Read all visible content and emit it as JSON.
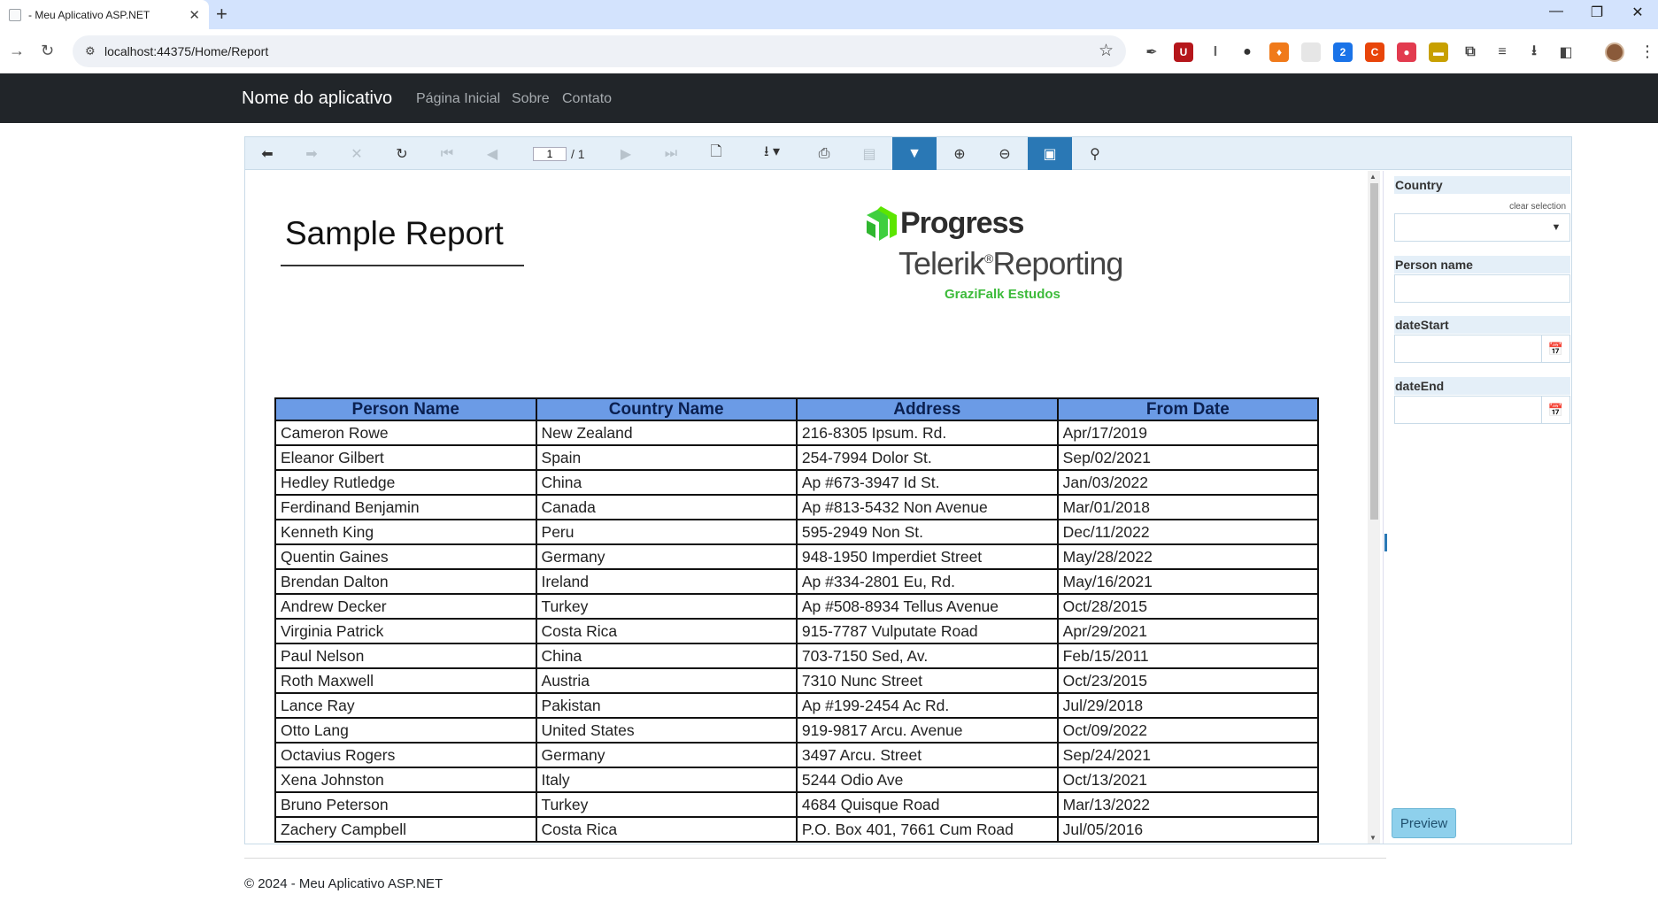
{
  "browser": {
    "tab_title": "- Meu Aplicativo ASP.NET",
    "url": "localhost:44375/Home/Report",
    "extensions": [
      {
        "name": "eyedropper-icon",
        "glyph": "✒",
        "color": "#444444"
      },
      {
        "name": "ublock-icon",
        "glyph": "U",
        "color": "#b5161b"
      },
      {
        "name": "italic-ext-icon",
        "glyph": "I",
        "color": "#666666"
      },
      {
        "name": "pets-ext-icon",
        "glyph": "●",
        "color": "#333333"
      },
      {
        "name": "fire-ext-icon",
        "glyph": "♦",
        "color": "#f07a1a"
      },
      {
        "name": "blank-ext-icon",
        "glyph": "",
        "color": "#e6e6e6"
      },
      {
        "name": "number-ext-icon",
        "glyph": "2",
        "color": "#1a73e8"
      },
      {
        "name": "c-ext-icon",
        "glyph": "C",
        "color": "#e8450a"
      },
      {
        "name": "red-circle-ext-icon",
        "glyph": "●",
        "color": "#e23b4f"
      },
      {
        "name": "folder-ext-icon",
        "glyph": "▬",
        "color": "#c8a000"
      },
      {
        "name": "puzzle-icon",
        "glyph": "⧉",
        "color": "#444444"
      },
      {
        "name": "media-icon",
        "glyph": "≡",
        "color": "#444444"
      },
      {
        "name": "download-icon",
        "glyph": "⭳",
        "color": "#444444"
      },
      {
        "name": "sidepanel-icon",
        "glyph": "◧",
        "color": "#444444"
      }
    ]
  },
  "site": {
    "brand": "Nome do aplicativo",
    "nav": [
      "Página Inicial",
      "Sobre",
      "Contato"
    ],
    "footer": "© 2024 - Meu Aplicativo ASP.NET"
  },
  "toolbar": {
    "current_page": "1",
    "page_total": "/ 1"
  },
  "report": {
    "title": "Sample Report",
    "logo_line1": "Progress",
    "logo_line2": "Telerik",
    "logo_line2b": "Reporting",
    "logo_reg": "®",
    "logo_line3": "GraziFalk Estudos",
    "columns": [
      "Person Name",
      "Country Name",
      "Address",
      "From Date"
    ],
    "rows": [
      [
        "Cameron Rowe",
        "New Zealand",
        "216-8305 Ipsum. Rd.",
        "Apr/17/2019"
      ],
      [
        "Eleanor Gilbert",
        "Spain",
        "254-7994 Dolor St.",
        "Sep/02/2021"
      ],
      [
        "Hedley Rutledge",
        "China",
        "Ap #673-3947 Id St.",
        "Jan/03/2022"
      ],
      [
        "Ferdinand Benjamin",
        "Canada",
        "Ap #813-5432 Non Avenue",
        "Mar/01/2018"
      ],
      [
        "Kenneth King",
        "Peru",
        "595-2949 Non St.",
        "Dec/11/2022"
      ],
      [
        "Quentin Gaines",
        "Germany",
        "948-1950 Imperdiet Street",
        "May/28/2022"
      ],
      [
        "Brendan Dalton",
        "Ireland",
        "Ap #334-2801 Eu, Rd.",
        "May/16/2021"
      ],
      [
        "Andrew Decker",
        "Turkey",
        "Ap #508-8934 Tellus Avenue",
        "Oct/28/2015"
      ],
      [
        "Virginia Patrick",
        "Costa Rica",
        "915-7787 Vulputate Road",
        "Apr/29/2021"
      ],
      [
        "Paul Nelson",
        "China",
        "703-7150 Sed, Av.",
        "Feb/15/2011"
      ],
      [
        "Roth Maxwell",
        "Austria",
        "7310 Nunc Street",
        "Oct/23/2015"
      ],
      [
        "Lance Ray",
        "Pakistan",
        "Ap #199-2454 Ac Rd.",
        "Jul/29/2018"
      ],
      [
        "Otto Lang",
        "United States",
        "919-9817 Arcu. Avenue",
        "Oct/09/2022"
      ],
      [
        "Octavius Rogers",
        "Germany",
        "3497 Arcu. Street",
        "Sep/24/2021"
      ],
      [
        "Xena Johnston",
        "Italy",
        "5244 Odio Ave",
        "Oct/13/2021"
      ],
      [
        "Bruno Peterson",
        "Turkey",
        "4684 Quisque Road",
        "Mar/13/2022"
      ],
      [
        "Zachery Campbell",
        "Costa Rica",
        "P.O. Box 401, 7661 Cum Road",
        "Jul/05/2016"
      ]
    ]
  },
  "parameters": {
    "country_label": "Country",
    "clear_selection": "clear selection",
    "country_value": "",
    "person_label": "Person name",
    "person_value": "",
    "date_start_label": "dateStart",
    "date_start_value": "",
    "date_end_label": "dateEnd",
    "date_end_value": "",
    "preview_label": "Preview"
  }
}
